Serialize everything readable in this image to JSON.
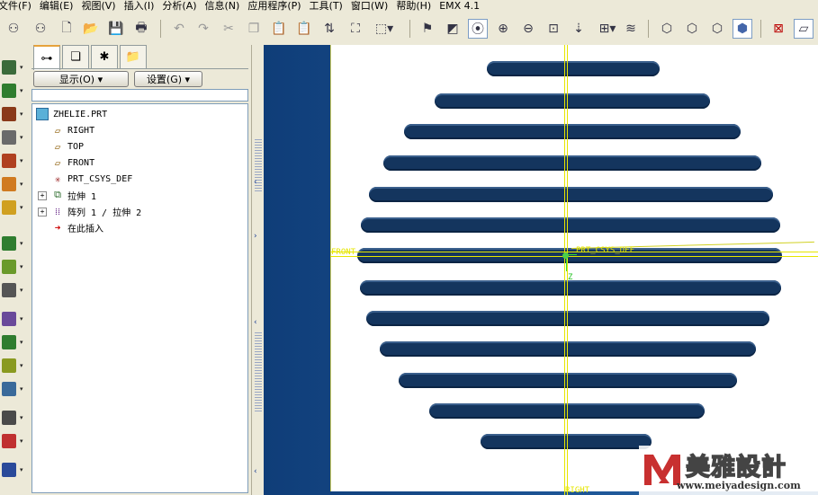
{
  "menu": [
    "文件(F)",
    "编辑(E)",
    "视图(V)",
    "插入(I)",
    "分析(A)",
    "信息(N)",
    "应用程序(P)",
    "工具(T)",
    "窗口(W)",
    "帮助(H)",
    "EMX 4.1"
  ],
  "nav": {
    "show_label": "显示(O) ▾",
    "settings_label": "设置(G) ▾",
    "tabs": [
      "model-tree-tab",
      "layer-tab",
      "favorites-tab",
      "folder-tab"
    ]
  },
  "tree": {
    "root": "ZHELIE.PRT",
    "items": [
      "RIGHT",
      "TOP",
      "FRONT",
      "PRT_CSYS_DEF",
      "拉伸 1",
      "阵列 1 / 拉伸 2",
      "在此插入"
    ]
  },
  "viewport": {
    "labels": {
      "front": "FRONT",
      "csys": "PRT_CSYS_DEF",
      "right": "RIGHT",
      "axis": "Z"
    },
    "slot_color": "#14355e",
    "datum_color": "#e6e600",
    "background_color": "#1d5596"
  },
  "watermark": {
    "title": "美雅設計",
    "url": "www.meiyadesign.com"
  }
}
